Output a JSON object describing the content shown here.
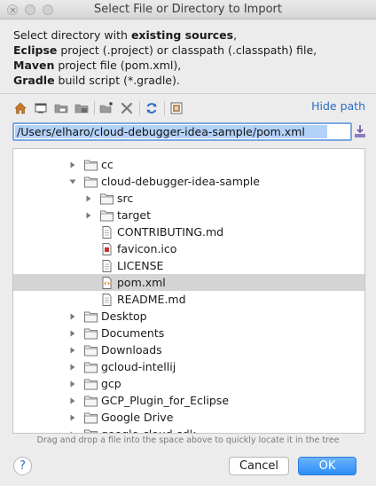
{
  "window": {
    "title": "Select File or Directory to Import"
  },
  "description": {
    "line1_prefix": "Select directory with ",
    "line1_bold": "existing sources",
    "line1_suffix": ",",
    "line2_bold": "Eclipse",
    "line2_rest": " project (.project) or classpath (.classpath) file,",
    "line3_bold": "Maven",
    "line3_rest": " project file (pom.xml),",
    "line4_bold": "Gradle",
    "line4_rest": " build script (*.gradle)."
  },
  "toolbar": {
    "icons": [
      "home-icon",
      "desktop-icon",
      "project-folder-icon",
      "module-folder-icon",
      "new-folder-icon",
      "delete-icon",
      "refresh-icon",
      "show-hidden-icon"
    ],
    "hide_path_label": "Hide path"
  },
  "path": {
    "value": "/Users/elharo/cloud-debugger-idea-sample/pom.xml"
  },
  "tree": {
    "rows": [
      {
        "label": "cc",
        "type": "folder",
        "depth": 1,
        "arrow": "collapsed"
      },
      {
        "label": "cloud-debugger-idea-sample",
        "type": "folder",
        "depth": 1,
        "arrow": "expanded"
      },
      {
        "label": "src",
        "type": "folder",
        "depth": 2,
        "arrow": "collapsed"
      },
      {
        "label": "target",
        "type": "folder",
        "depth": 2,
        "arrow": "collapsed"
      },
      {
        "label": "CONTRIBUTING.md",
        "type": "file",
        "depth": 2,
        "arrow": "none"
      },
      {
        "label": "favicon.ico",
        "type": "image-file",
        "depth": 2,
        "arrow": "none"
      },
      {
        "label": "LICENSE",
        "type": "file",
        "depth": 2,
        "arrow": "none"
      },
      {
        "label": "pom.xml",
        "type": "xml-file",
        "depth": 2,
        "arrow": "none",
        "selected": true
      },
      {
        "label": "README.md",
        "type": "file",
        "depth": 2,
        "arrow": "none"
      },
      {
        "label": "Desktop",
        "type": "folder",
        "depth": 1,
        "arrow": "collapsed"
      },
      {
        "label": "Documents",
        "type": "folder",
        "depth": 1,
        "arrow": "collapsed"
      },
      {
        "label": "Downloads",
        "type": "folder",
        "depth": 1,
        "arrow": "collapsed"
      },
      {
        "label": "gcloud-intellij",
        "type": "folder",
        "depth": 1,
        "arrow": "collapsed"
      },
      {
        "label": "gcp",
        "type": "folder",
        "depth": 1,
        "arrow": "collapsed"
      },
      {
        "label": "GCP_Plugin_for_Eclipse",
        "type": "folder",
        "depth": 1,
        "arrow": "collapsed"
      },
      {
        "label": "Google Drive",
        "type": "folder",
        "depth": 1,
        "arrow": "collapsed"
      },
      {
        "label": "google-cloud-sdk",
        "type": "folder",
        "depth": 1,
        "arrow": "collapsed"
      }
    ]
  },
  "hint": "Drag and drop a file into the space above to quickly locate it in the tree",
  "buttons": {
    "help": "?",
    "cancel": "Cancel",
    "ok": "OK"
  },
  "colors": {
    "accent": "#2b6cc4",
    "ok_button": "#2b8ef8",
    "selection": "#d4d4d4",
    "folder": "#8a8a8a"
  }
}
